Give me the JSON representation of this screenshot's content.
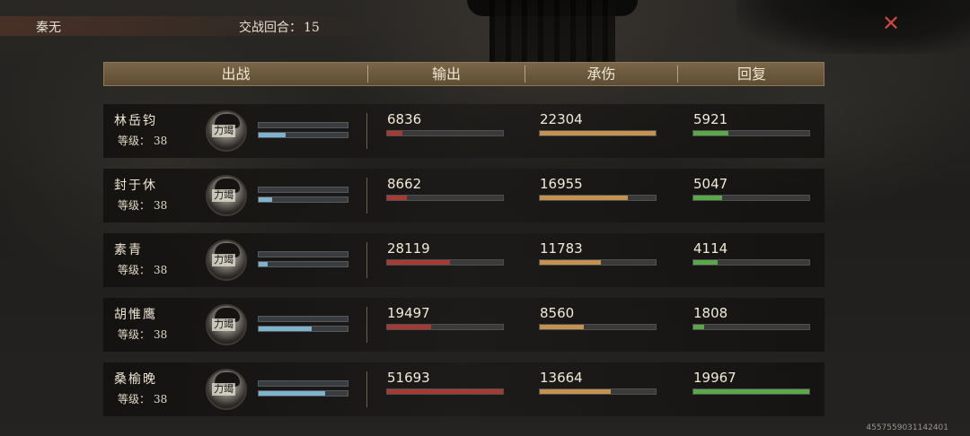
{
  "top": {
    "player_name": "秦无",
    "round_label": "交战回合：",
    "round_value": "15"
  },
  "header": {
    "col_fighter": "出战",
    "col_output": "输出",
    "col_damage_taken": "承伤",
    "col_heal": "回复"
  },
  "level_label": "等级：",
  "avatar_tag": "力竭",
  "rows": [
    {
      "name": "林岳钧",
      "level": "38",
      "output": "6836",
      "taken": "22304",
      "heal": "5921",
      "mini1": 0.0,
      "mini2": 0.3,
      "output_ratio": 0.13,
      "taken_ratio": 1.0,
      "heal_ratio": 0.3
    },
    {
      "name": "封于休",
      "level": "38",
      "output": "8662",
      "taken": "16955",
      "heal": "5047",
      "mini1": 0.0,
      "mini2": 0.15,
      "output_ratio": 0.17,
      "taken_ratio": 0.76,
      "heal_ratio": 0.25
    },
    {
      "name": "素青",
      "level": "38",
      "output": "28119",
      "taken": "11783",
      "heal": "4114",
      "mini1": 0.0,
      "mini2": 0.1,
      "output_ratio": 0.54,
      "taken_ratio": 0.53,
      "heal_ratio": 0.21
    },
    {
      "name": "胡惟鹰",
      "level": "38",
      "output": "19497",
      "taken": "8560",
      "heal": "1808",
      "mini1": 0.0,
      "mini2": 0.6,
      "output_ratio": 0.38,
      "taken_ratio": 0.38,
      "heal_ratio": 0.09
    },
    {
      "name": "桑榆晚",
      "level": "38",
      "output": "51693",
      "taken": "13664",
      "heal": "19967",
      "mini1": 0.0,
      "mini2": 0.75,
      "output_ratio": 1.0,
      "taken_ratio": 0.61,
      "heal_ratio": 1.0
    }
  ],
  "footer": {
    "id_text": "4557559031142401"
  },
  "colors": {
    "output_bar": "#a83a35",
    "taken_bar": "#c5924f",
    "heal_bar": "#5aa84a",
    "mini_bar": "#7fb2cc",
    "close": "#c9473d"
  },
  "icons": {
    "close": "close-icon"
  }
}
